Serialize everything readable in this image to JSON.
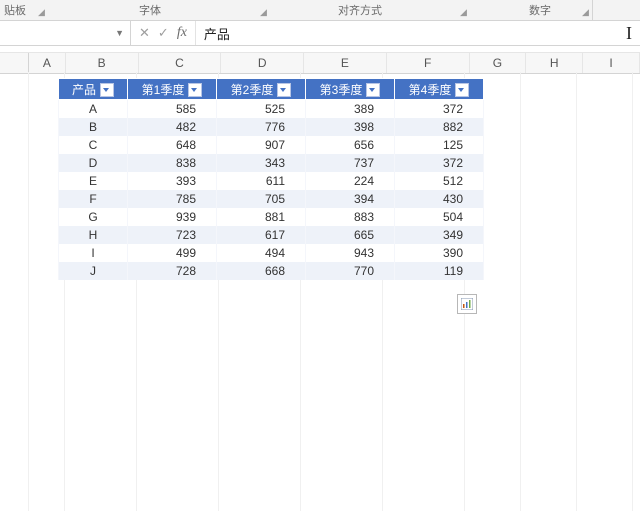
{
  "ribbon": {
    "group_clipboard": "贴板",
    "group_font": "字体",
    "group_align": "对齐方式",
    "group_number": "数字"
  },
  "formula_bar": {
    "name_box": "",
    "cancel_icon": "✕",
    "enter_icon": "✓",
    "fx_label": "fx",
    "value": "产品"
  },
  "columns": [
    "A",
    "B",
    "C",
    "D",
    "E",
    "F",
    "G",
    "H",
    "I"
  ],
  "table": {
    "headers": [
      "产品",
      "第1季度",
      "第2季度",
      "第3季度",
      "第4季度"
    ],
    "rows": [
      {
        "p": "A",
        "q1": 585,
        "q2": 525,
        "q3": 389,
        "q4": 372
      },
      {
        "p": "B",
        "q1": 482,
        "q2": 776,
        "q3": 398,
        "q4": 882
      },
      {
        "p": "C",
        "q1": 648,
        "q2": 907,
        "q3": 656,
        "q4": 125
      },
      {
        "p": "D",
        "q1": 838,
        "q2": 343,
        "q3": 737,
        "q4": 372
      },
      {
        "p": "E",
        "q1": 393,
        "q2": 611,
        "q3": 224,
        "q4": 512
      },
      {
        "p": "F",
        "q1": 785,
        "q2": 705,
        "q3": 394,
        "q4": 430
      },
      {
        "p": "G",
        "q1": 939,
        "q2": 881,
        "q3": 883,
        "q4": 504
      },
      {
        "p": "H",
        "q1": 723,
        "q2": 617,
        "q3": 665,
        "q4": 349
      },
      {
        "p": "I",
        "q1": 499,
        "q2": 494,
        "q3": 943,
        "q4": 390
      },
      {
        "p": "J",
        "q1": 728,
        "q2": 668,
        "q3": 770,
        "q4": 119
      }
    ]
  },
  "chart_data": {
    "type": "table",
    "title": "",
    "columns": [
      "产品",
      "第1季度",
      "第2季度",
      "第3季度",
      "第4季度"
    ],
    "rows": [
      [
        "A",
        585,
        525,
        389,
        372
      ],
      [
        "B",
        482,
        776,
        398,
        882
      ],
      [
        "C",
        648,
        907,
        656,
        125
      ],
      [
        "D",
        838,
        343,
        737,
        372
      ],
      [
        "E",
        393,
        611,
        224,
        512
      ],
      [
        "F",
        785,
        705,
        394,
        430
      ],
      [
        "G",
        939,
        881,
        883,
        504
      ],
      [
        "H",
        723,
        617,
        665,
        349
      ],
      [
        "I",
        499,
        494,
        943,
        390
      ],
      [
        "J",
        728,
        668,
        770,
        119
      ]
    ]
  }
}
